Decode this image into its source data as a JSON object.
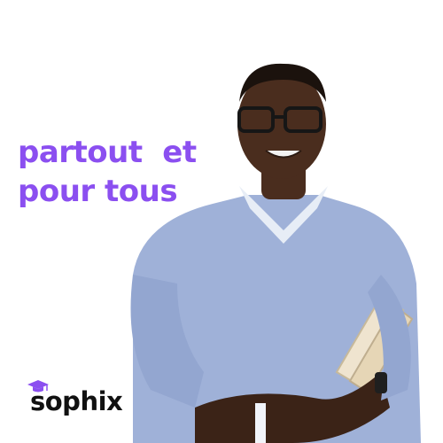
{
  "headline": {
    "line1": "partout  et",
    "line2": "pour tous"
  },
  "brand": {
    "name": "sophix",
    "accent_color": "#8b4ff0",
    "logo_icon": "graduation-cap-icon"
  },
  "photo": {
    "subject": "person-holding-books"
  }
}
